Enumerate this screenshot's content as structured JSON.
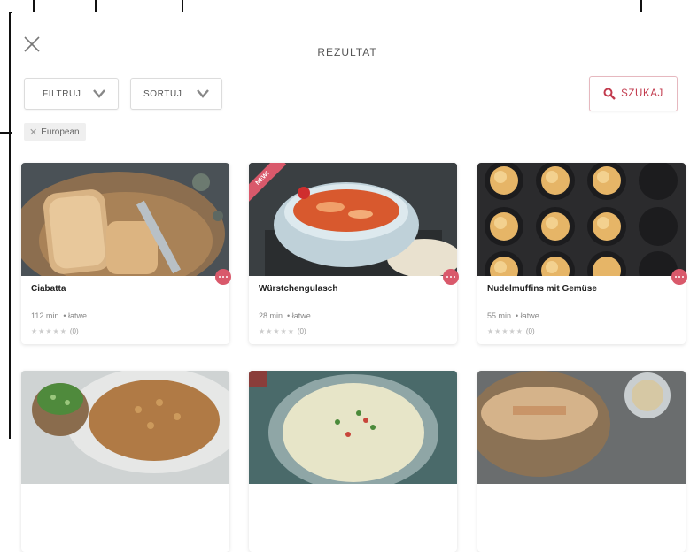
{
  "header": {
    "title": "REZULTAT"
  },
  "toolbar": {
    "filter_label": "FILTRUJ",
    "sort_label": "SORTUJ",
    "search_label": "SZUKAJ"
  },
  "active_filter": {
    "label": "European"
  },
  "icons": {
    "close": "close-icon",
    "chevron": "chevron-down-icon",
    "search": "search-icon",
    "more": "more-dots-icon"
  },
  "colors": {
    "accent": "#d9596b",
    "search_text": "#c23a4d"
  },
  "recipes": [
    {
      "title": "Ciabatta",
      "time": "112 min.",
      "difficulty": "łatwe",
      "rating_count": "(0)"
    },
    {
      "title": "Würstchengulasch",
      "time": "28 min.",
      "difficulty": "łatwe",
      "rating_count": "(0)",
      "badge": "NEW!"
    },
    {
      "title": "Nudelmuffins mit Gemüse",
      "time": "55 min.",
      "difficulty": "łatwe",
      "rating_count": "(0)"
    },
    {
      "title": ""
    },
    {
      "title": ""
    },
    {
      "title": ""
    }
  ],
  "meta_separator": "•",
  "stars": "★★★★★"
}
